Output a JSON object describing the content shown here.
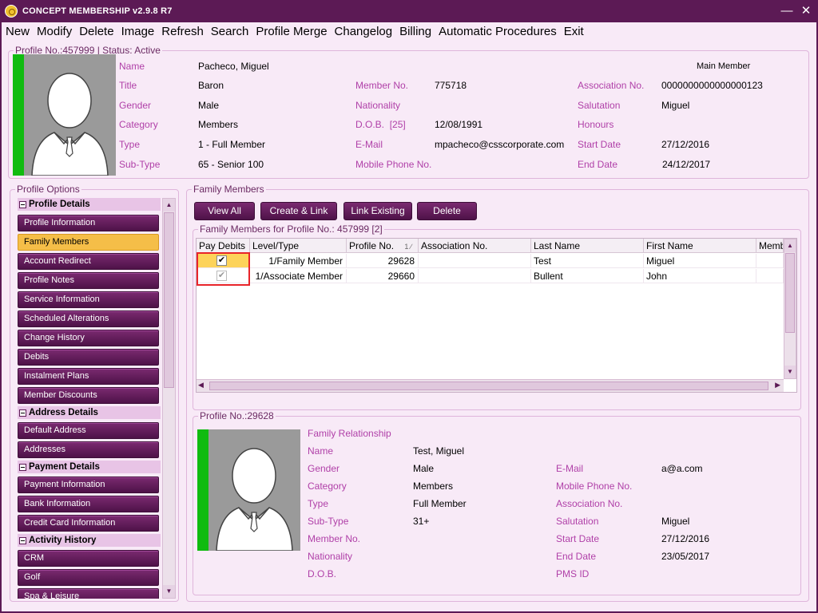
{
  "window": {
    "title": "CONCEPT MEMBERSHIP v2.9.8 R7"
  },
  "menu": [
    "New",
    "Modify",
    "Delete",
    "Image",
    "Refresh",
    "Search",
    "Profile Merge",
    "Changelog",
    "Billing",
    "Automatic Procedures",
    "Exit"
  ],
  "profile": {
    "legend": "Profile No.:457999 | Status: Active",
    "main_member": "Main Member",
    "labels": {
      "name": "Name",
      "title": "Title",
      "gender": "Gender",
      "category": "Category",
      "type": "Type",
      "subtype": "Sub-Type",
      "member_no": "Member No.",
      "nationality": "Nationality",
      "dob": "D.O.B.",
      "dob_age": "[25]",
      "email": "E-Mail",
      "mobile": "Mobile Phone No.",
      "assoc_no": "Association No.",
      "salutation": "Salutation",
      "honours": "Honours",
      "start_date": "Start Date",
      "end_date": "End Date"
    },
    "values": {
      "name": "Pacheco, Miguel",
      "title": "Baron",
      "gender": "Male",
      "category": "Members",
      "type": "1 - Full Member",
      "subtype": "65 - Senior 100",
      "member_no": "775718",
      "nationality": "",
      "dob": "12/08/1991",
      "email": "mpacheco@csscorporate.com",
      "mobile": "",
      "assoc_no": "0000000000000000123",
      "salutation": "Miguel",
      "honours": "",
      "start_date": "27/12/2016",
      "end_date": "24/12/2017"
    }
  },
  "sidebar": {
    "legend": "Profile Options",
    "sections": [
      {
        "title": "Profile Details",
        "items": [
          "Profile Information",
          "Family Members",
          "Account Redirect",
          "Profile Notes",
          "Service Information",
          "Scheduled Alterations",
          "Change History",
          "Debits",
          "Instalment Plans",
          "Member Discounts"
        ]
      },
      {
        "title": "Address Details",
        "items": [
          "Default Address",
          "Addresses"
        ]
      },
      {
        "title": "Payment Details",
        "items": [
          "Payment Information",
          "Bank Information",
          "Credit Card Information"
        ]
      },
      {
        "title": "Activity History",
        "items": [
          "CRM",
          "Golf",
          "Spa & Leisure"
        ]
      }
    ],
    "active_item": "Family Members"
  },
  "family": {
    "legend": "Family Members",
    "buttons": {
      "view_all": "View All",
      "create_link": "Create & Link",
      "link_existing": "Link Existing",
      "delete": "Delete"
    },
    "grid_legend": "Family Members for Profile No.: 457999 [2]",
    "columns": [
      "Pay Debits",
      "Level/Type",
      "Profile No.",
      "Association No.",
      "Last Name",
      "First Name",
      "Memb"
    ],
    "sort_indicator": "1 ∕",
    "rows": [
      {
        "pay_debits": "checked",
        "level_type": "1/Family Member",
        "profile_no": "29628",
        "assoc_no": "",
        "last_name": "Test",
        "first_name": "Miguel"
      },
      {
        "pay_debits": "checked-disabled",
        "level_type": "1/Associate Member",
        "profile_no": "29660",
        "assoc_no": "",
        "last_name": "Bullent",
        "first_name": "John"
      }
    ]
  },
  "detail": {
    "legend": "Profile No.:29628",
    "labels": {
      "relationship": "Family Relationship",
      "name": "Name",
      "gender": "Gender",
      "category": "Category",
      "type": "Type",
      "subtype": "Sub-Type",
      "member_no": "Member No.",
      "nationality": "Nationality",
      "dob": "D.O.B.",
      "email": "E-Mail",
      "mobile": "Mobile Phone No.",
      "assoc_no": "Association No.",
      "salutation": "Salutation",
      "start_date": "Start Date",
      "end_date": "End Date",
      "pms_id": "PMS ID"
    },
    "values": {
      "name": "Test, Miguel",
      "gender": "Male",
      "category": "Members",
      "type": "Full Member",
      "subtype": "31+",
      "member_no": "",
      "nationality": "",
      "dob": "",
      "email": "a@a.com",
      "mobile": "",
      "assoc_no": "",
      "salutation": "Miguel",
      "start_date": "27/12/2016",
      "end_date": "23/05/2017",
      "pms_id": ""
    }
  },
  "colors": {
    "frame": "#5c1a55",
    "accent_label": "#b040a8",
    "active_tab": "#f5be48",
    "status_green": "#10bb10",
    "highlight": "#e8242a"
  }
}
